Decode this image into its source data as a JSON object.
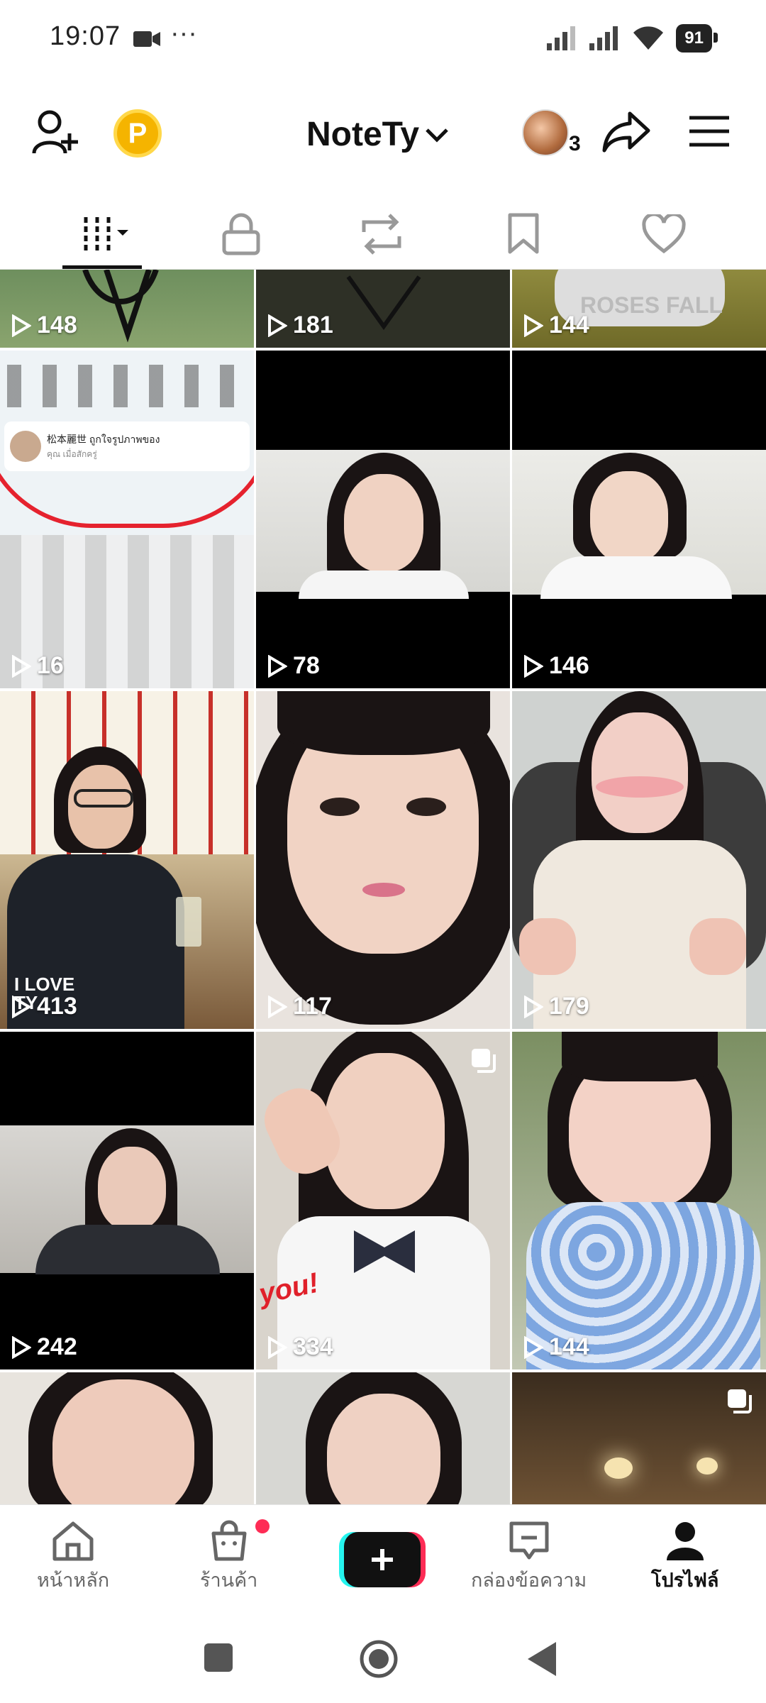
{
  "status_bar": {
    "time": "19:07",
    "dots": "···",
    "battery": "91"
  },
  "header": {
    "title": "NoteTy",
    "coin_label": "P",
    "avatar_count": "3"
  },
  "tabs": [
    {
      "name": "videos-tab",
      "active": true
    },
    {
      "name": "private-tab"
    },
    {
      "name": "reposts-tab"
    },
    {
      "name": "favorites-tab"
    },
    {
      "name": "liked-tab"
    }
  ],
  "grid": {
    "tiles": [
      {
        "views": "148"
      },
      {
        "views": "181"
      },
      {
        "views": "144"
      },
      {
        "views": "16"
      },
      {
        "views": "78"
      },
      {
        "views": "146"
      },
      {
        "views": "413"
      },
      {
        "views": "117"
      },
      {
        "views": "179"
      },
      {
        "views": "242"
      },
      {
        "views": "334"
      },
      {
        "views": "144"
      },
      {
        "views": ""
      },
      {
        "views": ""
      },
      {
        "views": ""
      }
    ],
    "tile1_text": "ROSES FALL",
    "tile2_caption_name": "松本麗世",
    "tile2_caption_text": "ถูกใจรูปภาพของ",
    "tile2_caption_sub": "คุณ เมื่อสักครู่",
    "tile4_overlay": "I LOVE TY",
    "tile7_overlay": "you!"
  },
  "bottom_nav": {
    "home": "หน้าหลัก",
    "shop": "ร้านค้า",
    "inbox": "กล่องข้อความ",
    "profile": "โปรไฟล์"
  },
  "colors": {
    "accent": "#fe2c55",
    "cyan": "#25f4ee",
    "coin": "#f5b400"
  }
}
